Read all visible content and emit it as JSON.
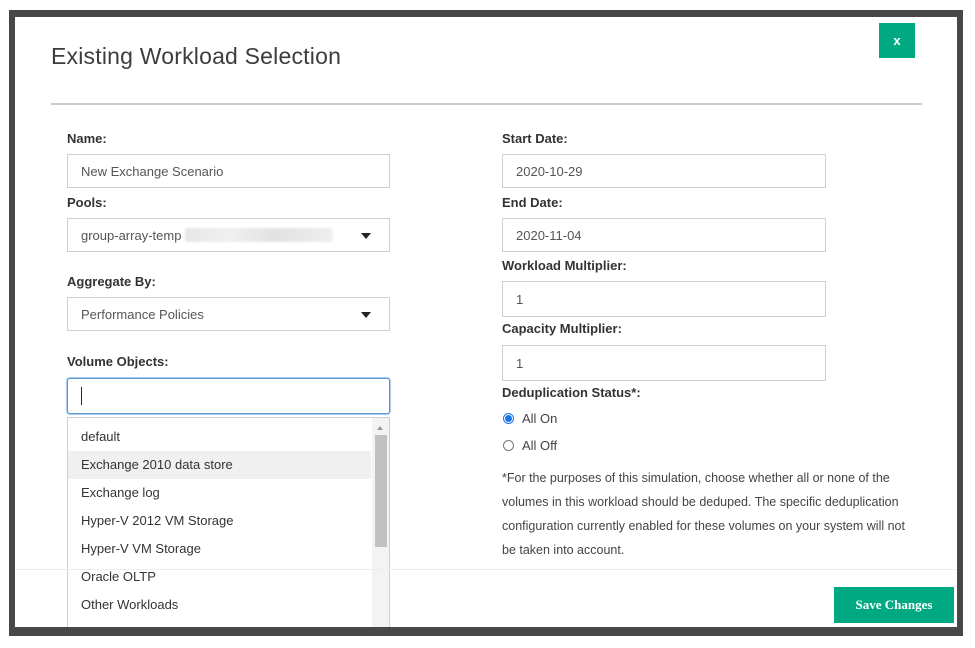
{
  "dialog": {
    "title": "Existing Workload Selection",
    "close_label": "x",
    "save_label": "Save Changes"
  },
  "form": {
    "name_label": "Name:",
    "name_value": "New Exchange Scenario",
    "pools_label": "Pools:",
    "pools_value": "group-array-temp",
    "aggregate_label": "Aggregate By:",
    "aggregate_value": "Performance Policies",
    "volume_label": "Volume Objects:",
    "volume_value": "",
    "start_label": "Start Date:",
    "start_value": "2020-10-29",
    "end_label": "End Date:",
    "end_value": "2020-11-04",
    "workload_mult_label": "Workload Multiplier:",
    "workload_mult_value": "1",
    "capacity_mult_label": "Capacity Multiplier:",
    "capacity_mult_value": "1",
    "dedup_label": "Deduplication Status*:",
    "dedup_options": [
      "All On",
      "All Off"
    ],
    "dedup_selected": "All On",
    "note": "*For the purposes of this simulation, choose whether all or none of the volumes in this workload should be deduped. The specific deduplication configuration currently enabled for these volumes on your system will not be taken into account."
  },
  "volume_options": [
    "default",
    "Exchange 2010 data store",
    "Exchange log",
    "Hyper-V 2012 VM Storage",
    "Hyper-V VM Storage",
    "Oracle OLTP",
    "Other Workloads"
  ],
  "highlighted_option": "Exchange 2010 data store",
  "colors": {
    "accent": "#01a982",
    "focus": "#5b9bd5",
    "radio": "#1a73e8"
  }
}
